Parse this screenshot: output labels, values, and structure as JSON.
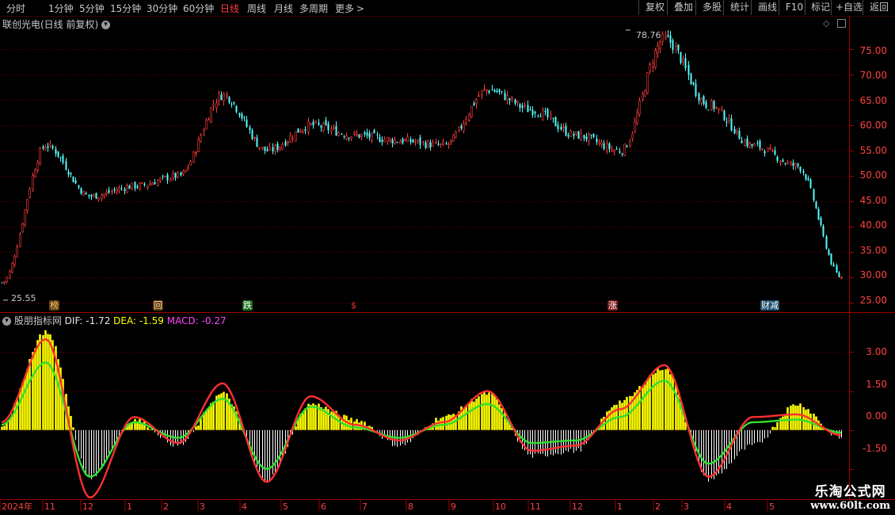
{
  "toolbar": {
    "periods": [
      "分时",
      "1分钟",
      "5分钟",
      "15分钟",
      "30分钟",
      "60分钟",
      "日线",
      "周线",
      "月线",
      "多周期",
      "更多"
    ],
    "active_period": "日线",
    "more_arrow": ">",
    "buttons": [
      "复权",
      "叠加",
      "多股",
      "统计",
      "画线",
      "F10",
      "标记",
      "+自选",
      "返回"
    ]
  },
  "stock": {
    "title": "联创光电(日线 前复权)",
    "dropdown_icon": "chevron-down-icon",
    "high_label": "78.76",
    "low_label": "25.55"
  },
  "indicator": {
    "name": "股朋指标网",
    "dif": "DIF: -1.72",
    "dea": "DEA: -1.59",
    "macd": "MACD: -0.27"
  },
  "price_axis": [
    "75.00",
    "70.00",
    "65.00",
    "60.00",
    "55.00",
    "50.00",
    "45.00",
    "40.00",
    "35.00",
    "30.00",
    "25.00"
  ],
  "macd_axis": [
    "3.00",
    "1.50",
    "0.00",
    "-1.50"
  ],
  "time_axis": [
    "2024年",
    "11",
    "12",
    "1",
    "2",
    "3",
    "4",
    "5",
    "6",
    "7",
    "8",
    "9",
    "10",
    "11",
    "12",
    "1",
    "2",
    "3",
    "4",
    "5"
  ],
  "markers": [
    {
      "text": "榜",
      "color": "#ffcc66",
      "bg": "#5a3a10"
    },
    {
      "text": "回",
      "color": "#ffddaa",
      "bg": "#5a3a10"
    },
    {
      "text": "跌",
      "color": "#ffffff",
      "bg": "#1a6a1a"
    },
    {
      "text": "$",
      "color": "#ff3030",
      "bg": "transparent"
    },
    {
      "text": "涨",
      "color": "#ffffff",
      "bg": "#7a1a1a"
    },
    {
      "text": "财减",
      "color": "#ffffff",
      "bg": "#1a4a6a"
    }
  ],
  "watermark": {
    "line1": "乐淘公式网",
    "line2": "www.60lt.com"
  },
  "colors": {
    "up": "#ff3c3c",
    "down": "#54ffff",
    "grid": "#7a0000",
    "dif": "#ff3030",
    "dea": "#30e030",
    "bar_pos": "#ffff00",
    "bar_neg": "#ffffff"
  },
  "chart_data": [
    {
      "type": "candlestick",
      "title": "联创光电(日线 前复权)",
      "ylim": [
        23.5,
        80
      ],
      "x": [
        "2024-10",
        "2024-11",
        "2024-12",
        "2025-01",
        "2025-02",
        "2025-03",
        "2025-04",
        "2025-05",
        "2025-06",
        "2025-07",
        "2025-08",
        "2025-09",
        "2025-10",
        "2025-11",
        "2025-12",
        "2026-01",
        "2026-02",
        "2026-03",
        "2026-04",
        "2026-05"
      ],
      "close_trend": [
        29,
        56,
        46,
        48,
        50,
        66,
        55,
        60,
        58,
        57,
        56,
        67,
        63,
        58,
        55,
        77,
        64,
        56,
        52,
        30
      ],
      "annotations": [
        {
          "label": "78.76",
          "value": 78.76
        },
        {
          "label": "25.55",
          "value": 25.55
        }
      ]
    },
    {
      "type": "bar",
      "title": "股朋指标网",
      "ylim": [
        -2.6,
        4.2
      ],
      "series": [
        {
          "name": "DIF",
          "values": [
            0.3,
            3.5,
            -2.6,
            0.5,
            -0.5,
            1.8,
            -2.0,
            1.3,
            0.2,
            -0.4,
            0.3,
            1.5,
            -0.8,
            -0.6,
            0.8,
            2.5,
            -1.8,
            0.5,
            0.6,
            -0.2
          ]
        },
        {
          "name": "DEA",
          "values": [
            0.2,
            2.6,
            -1.8,
            0.3,
            -0.3,
            1.2,
            -1.5,
            0.9,
            0.1,
            -0.3,
            0.2,
            1.0,
            -0.5,
            -0.4,
            0.5,
            1.9,
            -1.3,
            0.3,
            0.4,
            -0.1
          ]
        },
        {
          "name": "MACD",
          "values": [
            0.2,
            3.8,
            -1.8,
            0.4,
            -0.6,
            1.4,
            -1.9,
            1.0,
            0.4,
            -0.6,
            0.5,
            1.4,
            -1.0,
            -0.8,
            1.1,
            2.4,
            -1.9,
            -0.6,
            1.0,
            -0.3
          ]
        }
      ]
    }
  ]
}
